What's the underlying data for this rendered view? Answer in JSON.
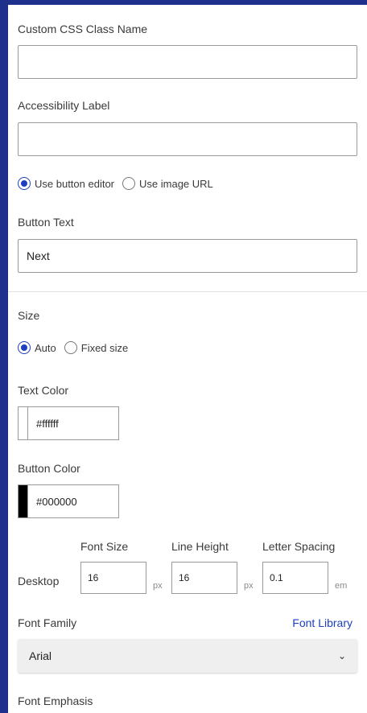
{
  "custom_css": {
    "label": "Custom CSS Class Name",
    "value": ""
  },
  "accessibility": {
    "label": "Accessibility Label",
    "value": ""
  },
  "source_mode": {
    "options": [
      {
        "label": "Use button editor",
        "checked": true
      },
      {
        "label": "Use image URL",
        "checked": false
      }
    ]
  },
  "button_text": {
    "label": "Button Text",
    "value": "Next"
  },
  "size": {
    "label": "Size",
    "options": [
      {
        "label": "Auto",
        "checked": true
      },
      {
        "label": "Fixed size",
        "checked": false
      }
    ]
  },
  "text_color": {
    "label": "Text Color",
    "value": "#ffffff",
    "swatch": "#ffffff"
  },
  "button_color": {
    "label": "Button Color",
    "value": "#000000",
    "swatch": "#000000"
  },
  "typography": {
    "row_label": "Desktop",
    "font_size": {
      "label": "Font Size",
      "value": "16",
      "unit": "px"
    },
    "line_height": {
      "label": "Line Height",
      "value": "16",
      "unit": "px"
    },
    "letter_spacing": {
      "label": "Letter Spacing",
      "value": "0.1",
      "unit": "em"
    }
  },
  "font_family": {
    "label": "Font Family",
    "link": "Font Library",
    "selected": "Arial",
    "chevron": "⌄"
  },
  "font_emphasis": {
    "label": "Font Emphasis"
  },
  "colors": {
    "accent": "#1e3fbf",
    "frame": "#1e2f8c"
  }
}
